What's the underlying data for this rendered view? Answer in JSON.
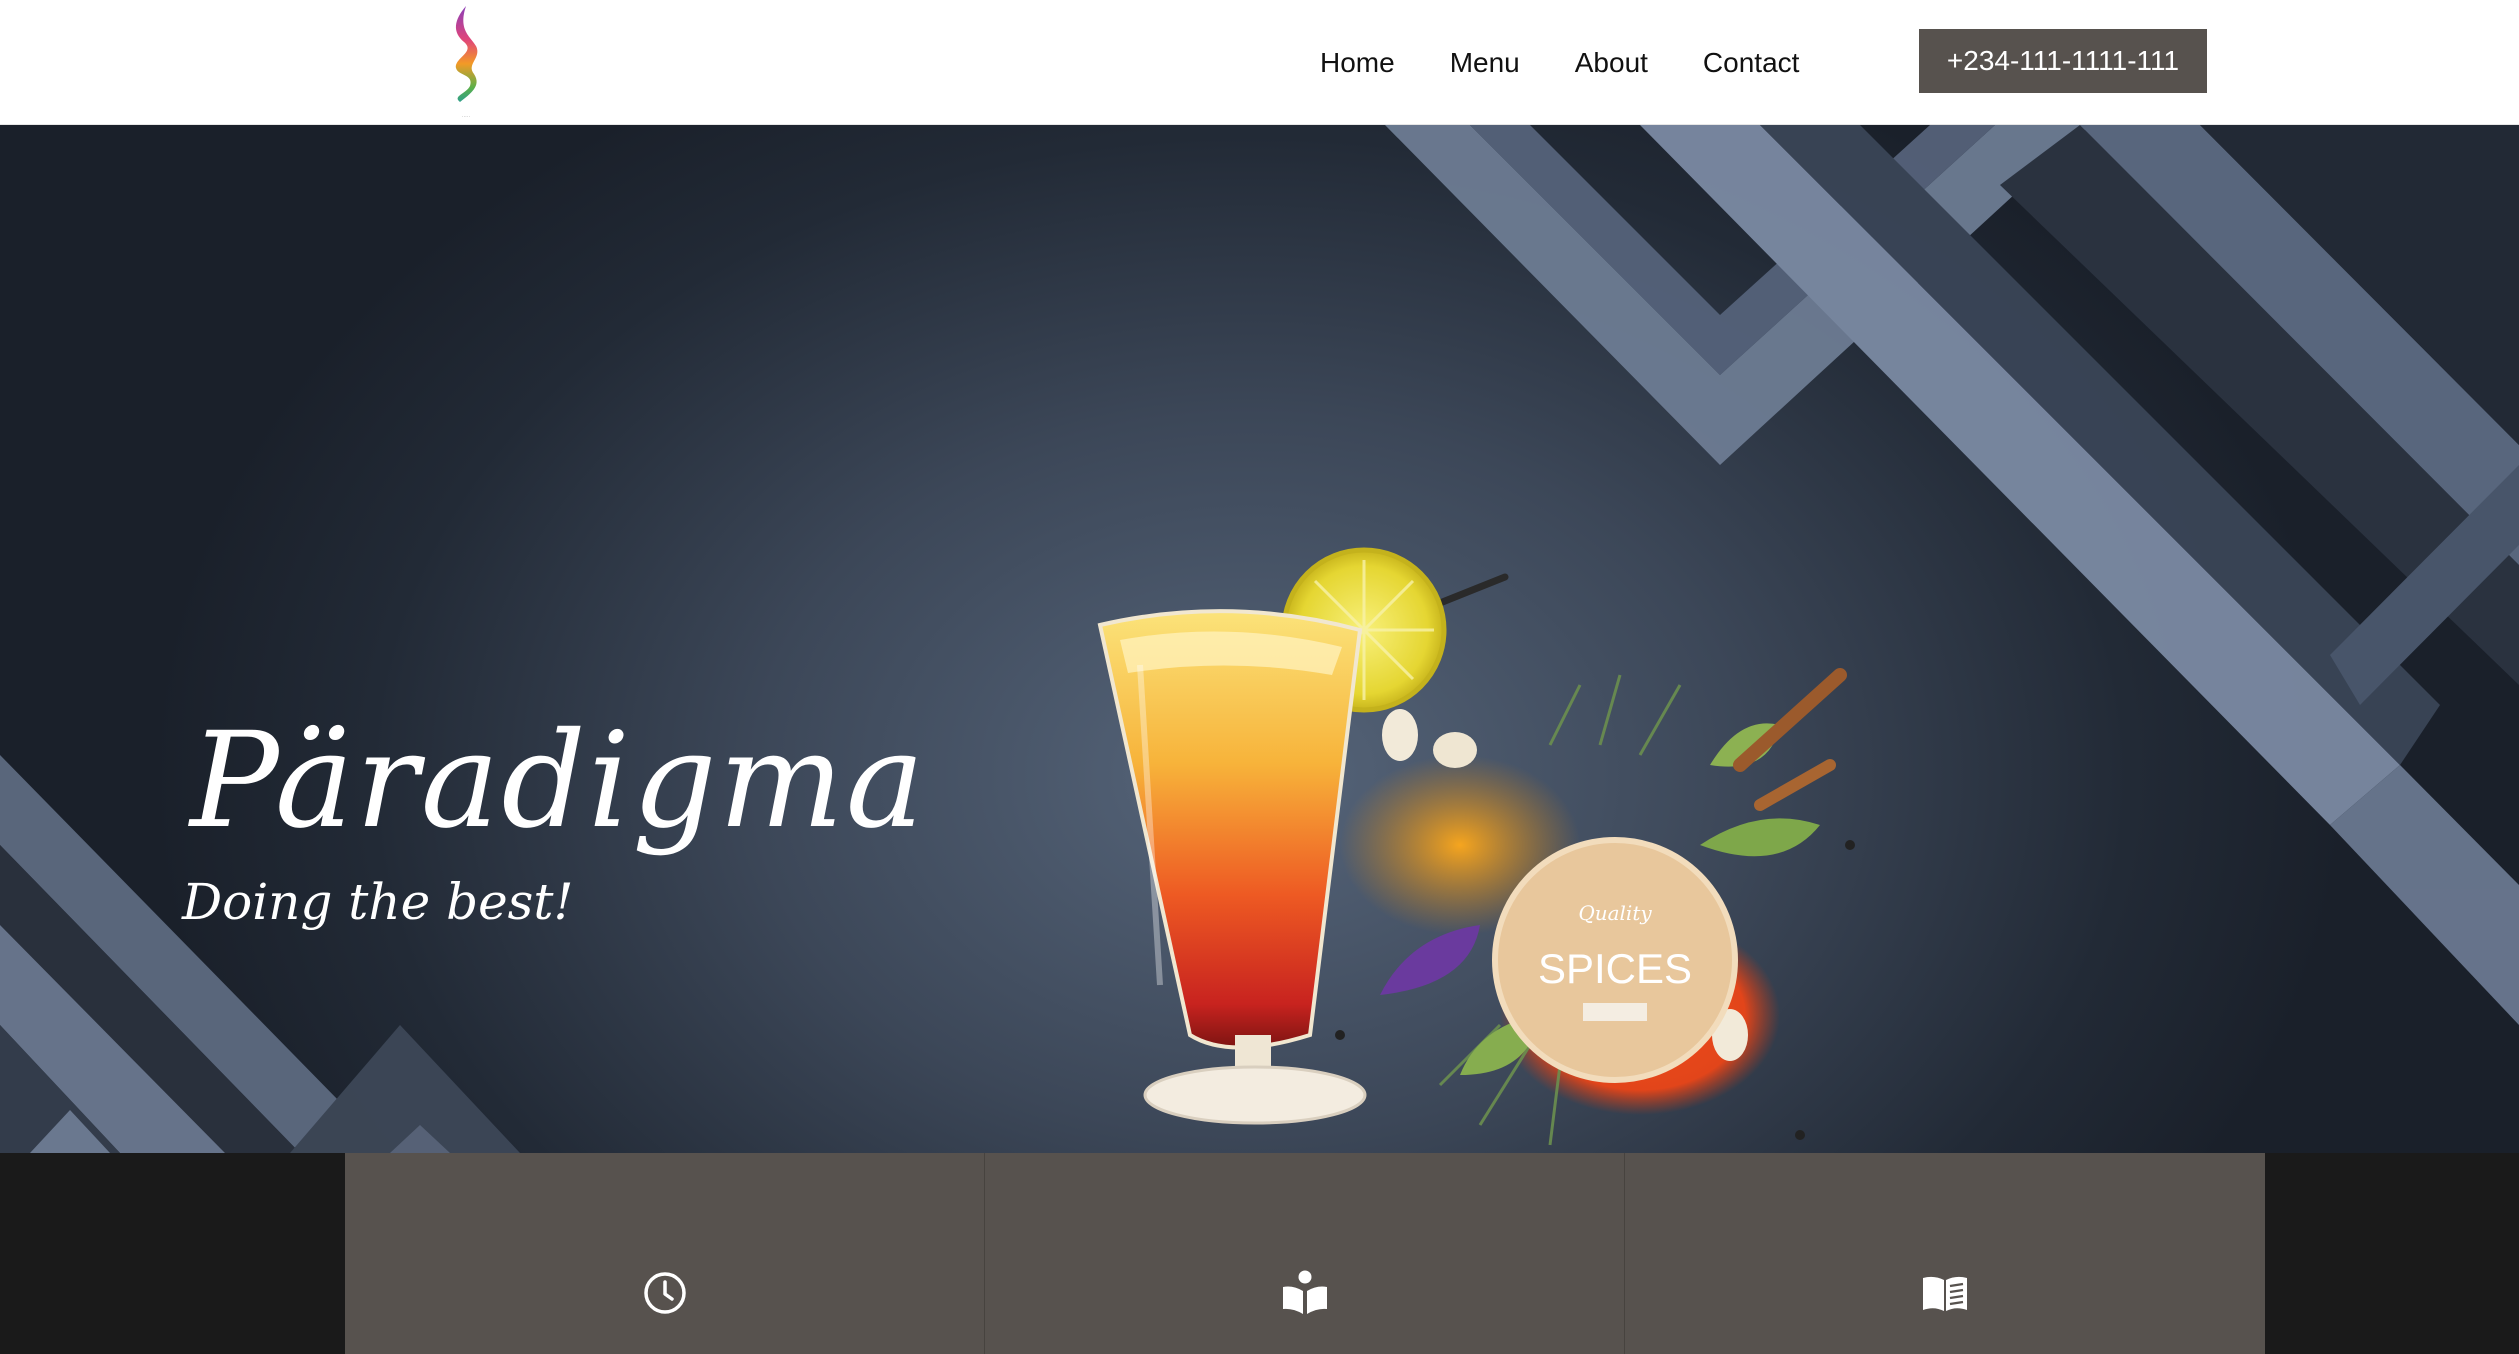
{
  "header": {
    "logo_icon": "brand-flame-s-logo",
    "nav": [
      "Home",
      "Menu",
      "About",
      "Contact"
    ],
    "phone": "+234-111-1111-111"
  },
  "hero": {
    "title": "Päradigma",
    "tagline": "Doing the best!",
    "spice_badge": {
      "top": "Quality",
      "main": "SPICES"
    }
  },
  "features": [
    {
      "icon": "clock-icon"
    },
    {
      "icon": "open-book-reader-icon"
    },
    {
      "icon": "menu-book-icon"
    }
  ],
  "colors": {
    "button_bg": "#57524e",
    "strip_bg": "#1a1a1a",
    "feature_bg": "#57524e",
    "hero_bg": "#3c4758"
  }
}
